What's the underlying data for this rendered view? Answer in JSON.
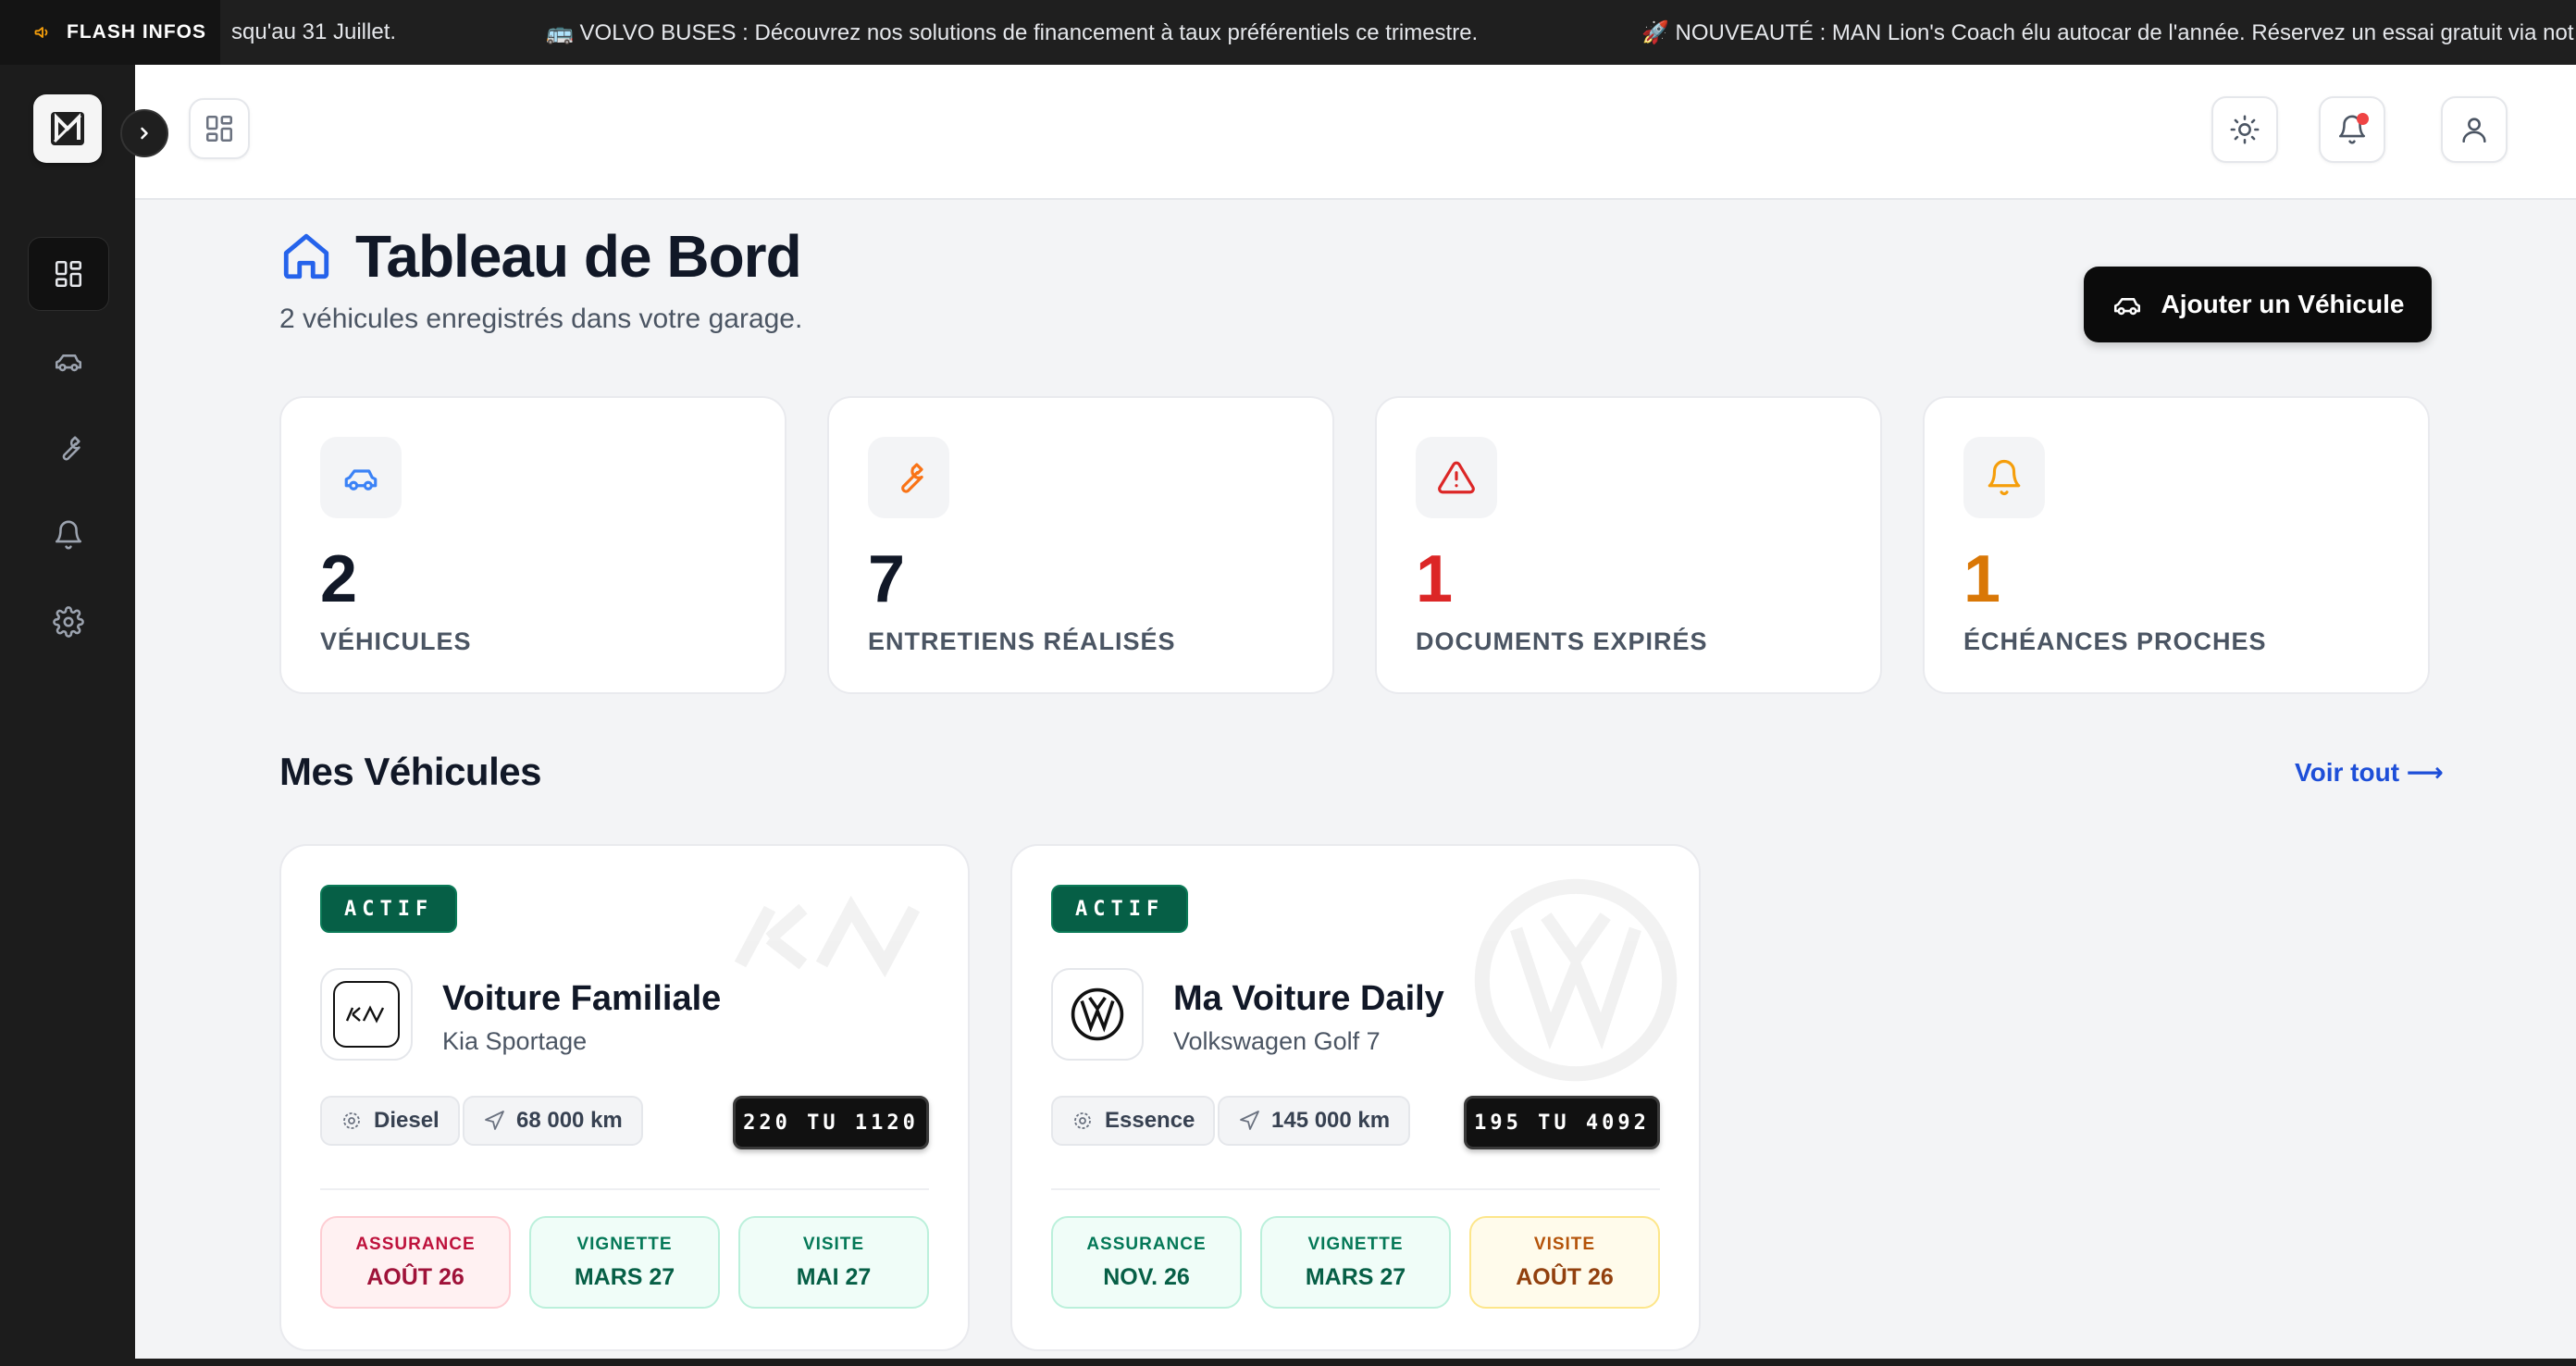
{
  "ticker": {
    "label": "FLASH INFOS",
    "messages": [
      "squ'au 31 Juillet.",
      "🚌 VOLVO BUSES : Découvrez nos solutions de financement à taux préférentiels ce trimestre.",
      "🚀 NOUVEAUTÉ : MAN Lion's Coach élu autocar de l'année. Réservez un essai gratuit via not"
    ]
  },
  "sidebar": {
    "items": [
      {
        "icon": "dashboard-icon",
        "active": true
      },
      {
        "icon": "car-icon",
        "active": false
      },
      {
        "icon": "wrench-icon",
        "active": false
      },
      {
        "icon": "bell-icon",
        "active": false
      },
      {
        "icon": "settings-icon",
        "active": false
      }
    ]
  },
  "header": {
    "title": "Tableau de Bord",
    "subtitle": "2 véhicules enregistrés dans votre garage.",
    "add_button": "Ajouter un Véhicule"
  },
  "stats": [
    {
      "value": "2",
      "label": "VÉHICULES",
      "icon": "car-icon",
      "color": "#111827",
      "icon_color": "#3b82f6"
    },
    {
      "value": "7",
      "label": "ENTRETIENS RÉALISÉS",
      "icon": "wrench-icon",
      "color": "#111827",
      "icon_color": "#f97316"
    },
    {
      "value": "1",
      "label": "DOCUMENTS EXPIRÉS",
      "icon": "warning-icon",
      "color": "#dc2626",
      "icon_color": "#dc2626"
    },
    {
      "value": "1",
      "label": "ÉCHÉANCES PROCHES",
      "icon": "bell-icon",
      "color": "#d97706",
      "icon_color": "#f59e0b"
    }
  ],
  "vehicles_section": {
    "title": "Mes Véhicules",
    "see_all": "Voir tout ⟶"
  },
  "vehicles": [
    {
      "status": "ACTIF",
      "name": "Voiture Familiale",
      "model": "Kia Sportage",
      "brand": "kia",
      "fuel": "Diesel",
      "mileage": "68 000 km",
      "plate": "220 TU 1120",
      "dues": [
        {
          "label": "ASSURANCE",
          "value": "AOÛT 26",
          "tone": "red"
        },
        {
          "label": "VIGNETTE",
          "value": "MARS 27",
          "tone": "green"
        },
        {
          "label": "VISITE",
          "value": "MAI 27",
          "tone": "green"
        }
      ]
    },
    {
      "status": "ACTIF",
      "name": "Ma Voiture Daily",
      "model": "Volkswagen Golf 7",
      "brand": "volkswagen",
      "fuel": "Essence",
      "mileage": "145 000 km",
      "plate": "195 TU 4092",
      "dues": [
        {
          "label": "ASSURANCE",
          "value": "NOV. 26",
          "tone": "green"
        },
        {
          "label": "VIGNETTE",
          "value": "MARS 27",
          "tone": "green"
        },
        {
          "label": "VISITE",
          "value": "AOÛT 26",
          "tone": "amber"
        }
      ]
    }
  ]
}
